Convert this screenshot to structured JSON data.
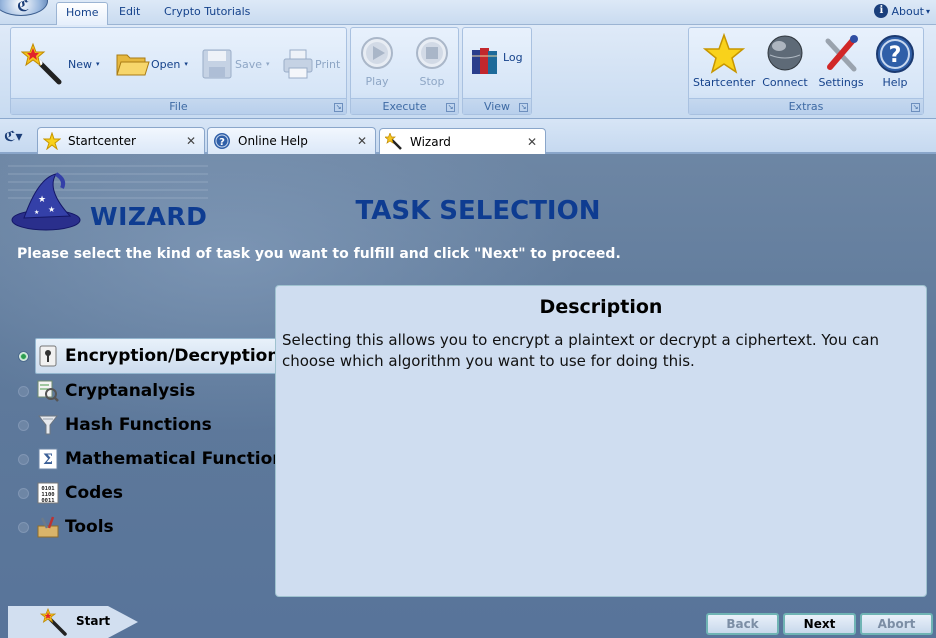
{
  "menu": {
    "tabs": [
      "Home",
      "Edit",
      "Crypto Tutorials"
    ],
    "active_tab": "Home",
    "about_label": "About"
  },
  "ribbon": {
    "file": {
      "label": "File",
      "new_label": "New",
      "open_label": "Open",
      "save_label": "Save",
      "print_label": "Print"
    },
    "execute": {
      "label": "Execute",
      "play_label": "Play",
      "stop_label": "Stop"
    },
    "view": {
      "label": "View",
      "log_label": "Log"
    },
    "extras": {
      "label": "Extras",
      "startcenter_label": "Startcenter",
      "connect_label": "Connect",
      "settings_label": "Settings",
      "help_label": "Help"
    }
  },
  "doc_tabs": [
    {
      "label": "Startcenter",
      "icon": "star-icon"
    },
    {
      "label": "Online Help",
      "icon": "help-icon"
    },
    {
      "label": "Wizard",
      "icon": "wand-icon"
    }
  ],
  "wizard": {
    "brand": "WIZARD",
    "title": "TASK SELECTION",
    "instruction": "Please select the kind of task you want to fulfill and click \"Next\" to proceed.",
    "options": [
      {
        "label": "Encryption/Decryption",
        "icon": "keyhole-icon",
        "selected": true
      },
      {
        "label": "Cryptanalysis",
        "icon": "analysis-icon",
        "selected": false
      },
      {
        "label": "Hash Functions",
        "icon": "funnel-icon",
        "selected": false
      },
      {
        "label": "Mathematical Functions",
        "icon": "sigma-icon",
        "selected": false
      },
      {
        "label": "Codes",
        "icon": "binary-icon",
        "selected": false
      },
      {
        "label": "Tools",
        "icon": "toolbox-icon",
        "selected": false
      }
    ],
    "description": {
      "title": "Description",
      "text": "Selecting this allows you to encrypt a plaintext or decrypt a ciphertext. You can choose which algorithm you want to use for doing this."
    },
    "start_label": "Start",
    "back_label": "Back",
    "next_label": "Next",
    "abort_label": "Abort"
  },
  "colors": {
    "accent": "#0e3c91",
    "background": "#5e7898",
    "panel": "#cfddf0"
  }
}
